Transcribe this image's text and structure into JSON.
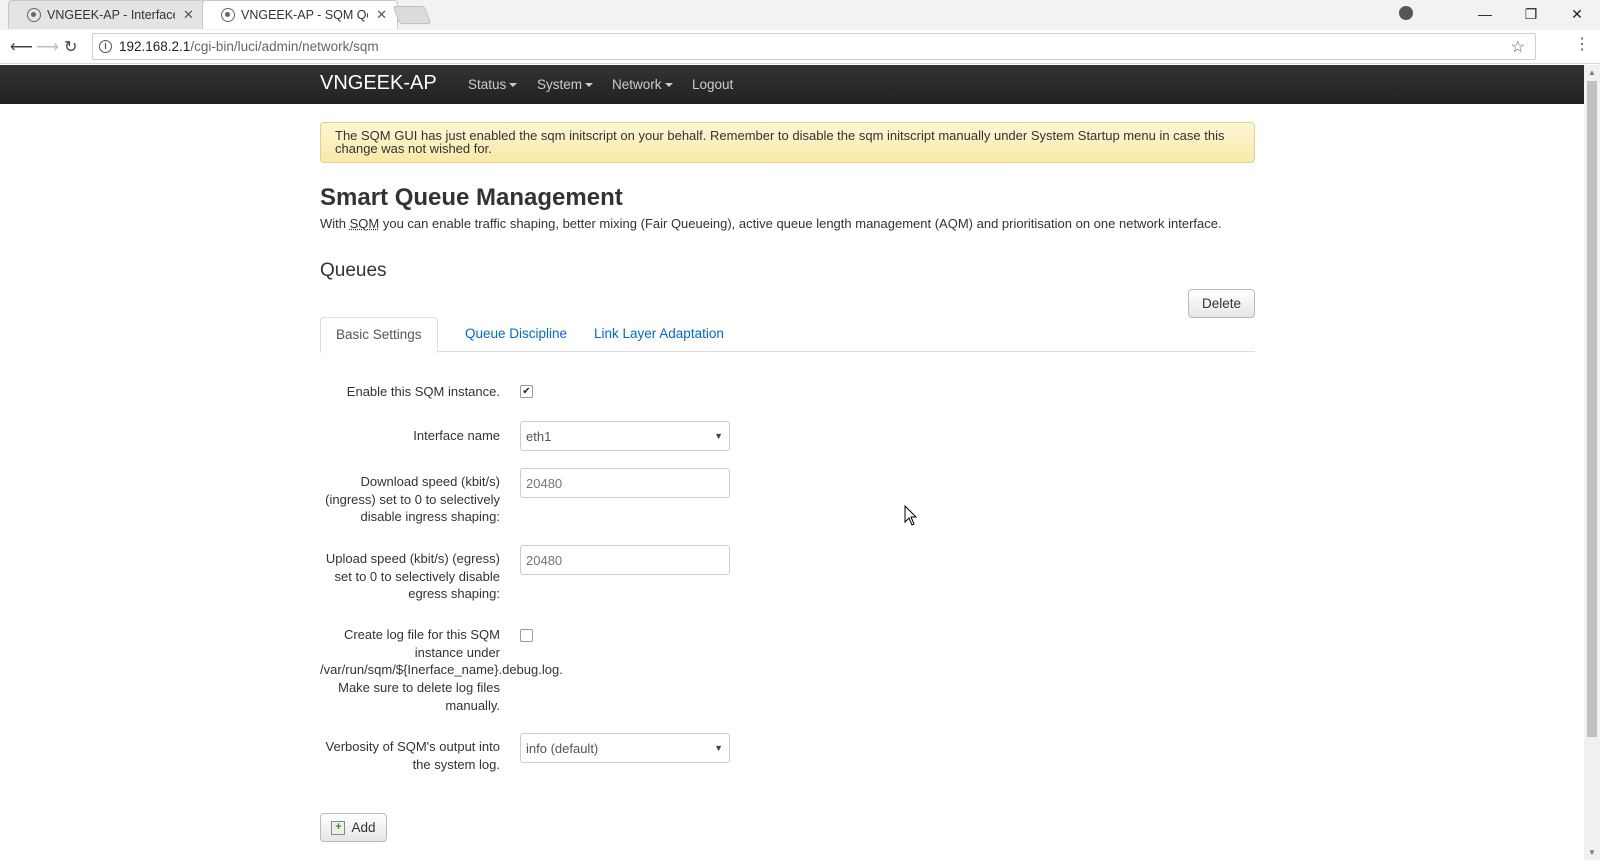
{
  "browser": {
    "tabs": [
      {
        "title": "VNGEEK-AP - Interfaces -",
        "close": "✕"
      },
      {
        "title": "VNGEEK-AP - SQM QoS -",
        "close": "✕"
      }
    ],
    "url_host": "192.168.2.1",
    "url_path": "/cgi-bin/luci/admin/network/sqm",
    "window_controls": {
      "minimize": "—",
      "restore": "❐",
      "close": "✕"
    }
  },
  "navbar": {
    "brand": "VNGEEK-AP",
    "items": [
      {
        "label": "Status",
        "dropdown": true
      },
      {
        "label": "System",
        "dropdown": true
      },
      {
        "label": "Network",
        "dropdown": true
      },
      {
        "label": "Logout",
        "dropdown": false
      }
    ]
  },
  "alert": {
    "text": "The SQM GUI has just enabled the sqm initscript on your behalf. Remember to disable the sqm initscript manually under System Startup menu in case this change was not wished for."
  },
  "page": {
    "title": "Smart Queue Management",
    "description_pre": "With ",
    "description_abbr": "SQM",
    "description_post": " you can enable traffic shaping, better mixing (Fair Queueing), active queue length management (AQM) and prioritisation on one network interface.",
    "section_title": "Queues",
    "delete_label": "Delete",
    "add_label": "Add"
  },
  "tabs": [
    {
      "label": "Basic Settings",
      "active": true
    },
    {
      "label": "Queue Discipline",
      "active": false
    },
    {
      "label": "Link Layer Adaptation",
      "active": false
    }
  ],
  "form": {
    "enable_label": "Enable this SQM instance.",
    "enable_checked": true,
    "interface_label": "Interface name",
    "interface_value": "eth1",
    "download_label": "Download speed (kbit/s) (ingress) set to 0 to selectively disable ingress shaping:",
    "download_placeholder": "20480",
    "upload_label": "Upload speed (kbit/s) (egress) set to 0 to selectively disable egress shaping:",
    "upload_placeholder": "20480",
    "log_label": "Create log file for this SQM instance under /var/run/sqm/${Inerface_name}.debug.log. Make sure to delete log files manually.",
    "log_checked": false,
    "verbosity_label": "Verbosity of SQM's output into the system log.",
    "verbosity_value": "info (default)"
  }
}
